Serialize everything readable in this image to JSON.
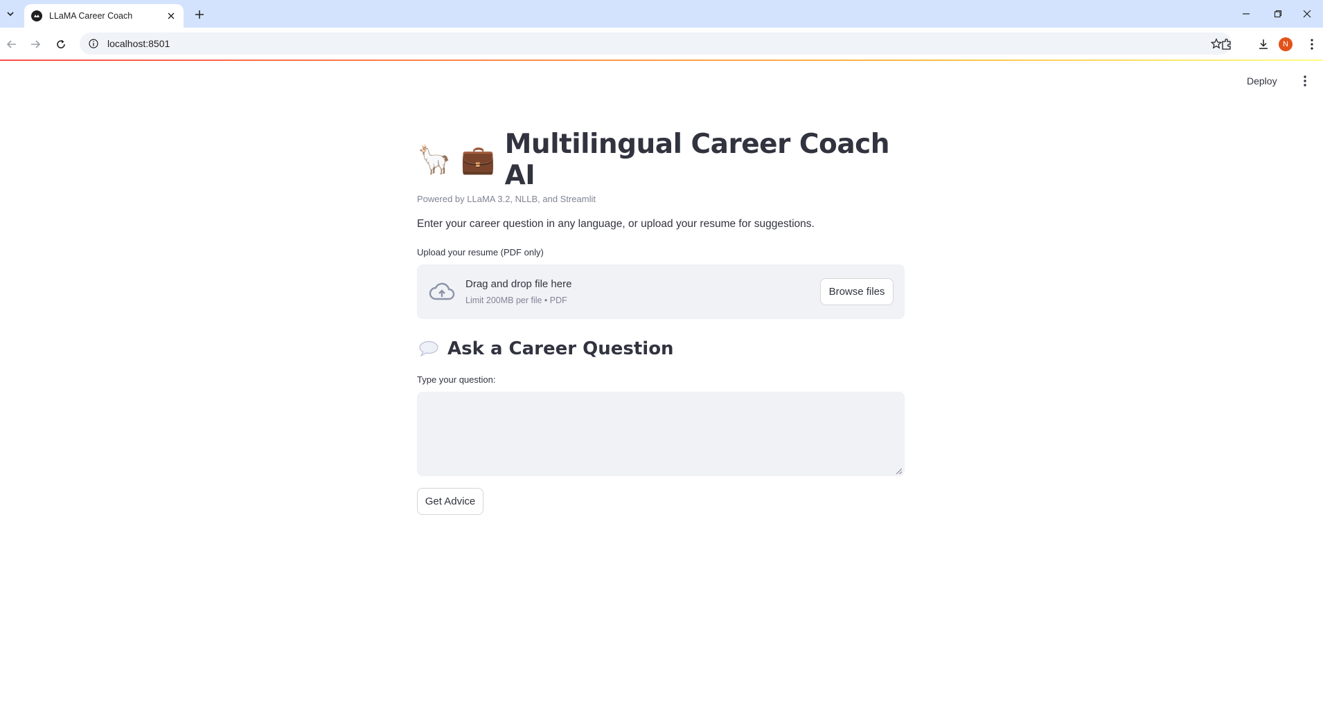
{
  "browser": {
    "tab_title": "LLaMA Career Coach",
    "url": "localhost:8501",
    "profile_initial": "N"
  },
  "app_header": {
    "deploy_label": "Deploy"
  },
  "page": {
    "title_emojis": [
      "🦙",
      "💼"
    ],
    "title": "Multilingual Career Coach AI",
    "caption": "Powered by LLaMA 3.2, NLLB, and Streamlit",
    "intro": "Enter your career question in any language, or upload your resume for suggestions."
  },
  "uploader": {
    "label": "Upload your resume (PDF only)",
    "drop_text": "Drag and drop file here",
    "limit_text": "Limit 200MB per file • PDF",
    "browse_label": "Browse files"
  },
  "question_section": {
    "icon": "speech-bubble-icon",
    "heading": "Ask a Career Question",
    "input_label": "Type your question:",
    "input_value": "",
    "submit_label": "Get Advice"
  },
  "colors": {
    "tabstrip": "#d3e3fd",
    "text": "#31333f",
    "muted": "#808495",
    "input_bg": "#f0f2f6",
    "profile": "#e2531b",
    "accent_red": "#ff4b4b"
  }
}
